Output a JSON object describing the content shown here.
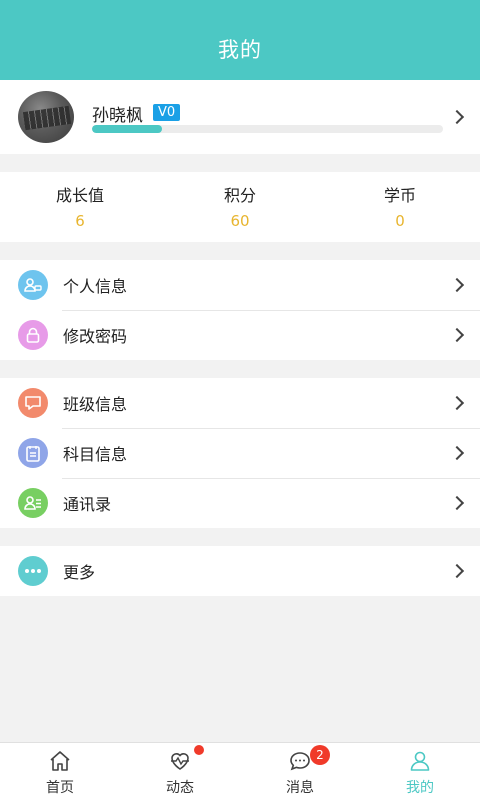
{
  "header": {
    "title": "我的"
  },
  "profile": {
    "name": "孙晓枫",
    "level": "V0",
    "progress_fraction": 0.2
  },
  "stats": [
    {
      "label": "成长值",
      "value": "6"
    },
    {
      "label": "积分",
      "value": "60"
    },
    {
      "label": "学币",
      "value": "0"
    }
  ],
  "menu": {
    "group1": [
      {
        "label": "个人信息",
        "icon": "person-card-icon",
        "color": "#6ec4ee"
      },
      {
        "label": "修改密码",
        "icon": "lock-icon",
        "color": "#e79be8"
      }
    ],
    "group2": [
      {
        "label": "班级信息",
        "icon": "chat-box-icon",
        "color": "#f28a6c"
      },
      {
        "label": "科目信息",
        "icon": "clipboard-icon",
        "color": "#8fa5e8"
      },
      {
        "label": "通讯录",
        "icon": "contacts-icon",
        "color": "#78cf62"
      }
    ],
    "group3": [
      {
        "label": "更多",
        "icon": "more-dots-icon",
        "color": "#5fcdd0"
      }
    ]
  },
  "tabbar": {
    "tabs": [
      {
        "label": "首页",
        "icon": "home-icon"
      },
      {
        "label": "动态",
        "icon": "heartbeat-icon"
      },
      {
        "label": "消息",
        "icon": "message-icon",
        "badge": "2"
      },
      {
        "label": "我的",
        "icon": "user-icon"
      }
    ],
    "active_color": "#4cc8c4"
  }
}
